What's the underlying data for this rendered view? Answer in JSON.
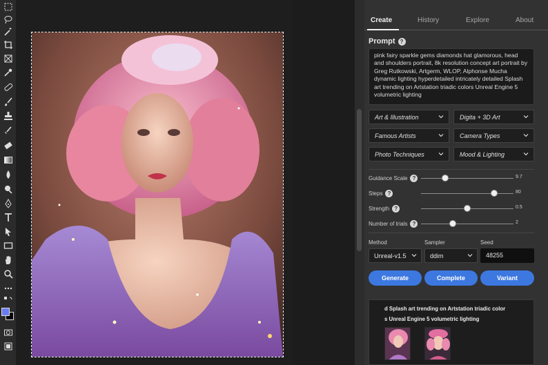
{
  "toolbar": {
    "tools": [
      "marquee-icon",
      "lasso-icon",
      "magic-wand-icon",
      "crop-icon",
      "frame-icon",
      "eyedropper-icon",
      "healing-brush-icon",
      "brush-icon",
      "clone-stamp-icon",
      "history-brush-icon",
      "eraser-icon",
      "gradient-icon",
      "blur-icon",
      "dodge-icon",
      "pen-icon",
      "type-icon",
      "path-select-icon",
      "rectangle-icon",
      "hand-icon",
      "zoom-icon",
      "more-icon"
    ],
    "foreground_color": "#6a7cf0",
    "background_color": "#000000"
  },
  "panel": {
    "tabs": [
      "Create",
      "History",
      "Explore",
      "About"
    ],
    "active_tab": "Create",
    "prompt_label": "Prompt",
    "prompt_text": "pink fairy sparkle gems diamonds hat glamorous, head and shoulders portrait, 8k resolution concept art portrait by Greg Rutkowski, Artgerm, WLOP, Alphonse Mucha dynamic lighting hyperdetailed intricately detailed Splash art trending on Artstation triadic colors Unreal Engine 5 volumetric lighting",
    "dropdowns": [
      "Art & Illustration",
      "Digita + 3D Art",
      "Famous Artists",
      "Camera Types",
      "Photo Techniques",
      "Mood & Lighting"
    ],
    "sliders": [
      {
        "label": "Guidance Scale",
        "value": "9.7",
        "fraction": 0.26
      },
      {
        "label": "Steps",
        "value": "80",
        "fraction": 0.79
      },
      {
        "label": "Strength",
        "value": "0.5",
        "fraction": 0.5
      },
      {
        "label": "Number of trials",
        "value": "2",
        "fraction": 0.34
      }
    ],
    "method_label": "Method",
    "method_value": "Unreal-v1.5",
    "sampler_label": "Sampler",
    "sampler_value": "ddim",
    "seed_label": "Seed",
    "seed_value": "48255",
    "buttons": {
      "generate": "Generate",
      "complete": "Complete",
      "variant": "Variant"
    },
    "history_text_1": "d Splash art trending on Artstation triadic color",
    "history_text_2": "s Unreal Engine 5 volumetric lighting"
  },
  "colors": {
    "accent": "#3d78e0",
    "panel_bg": "#323232"
  }
}
